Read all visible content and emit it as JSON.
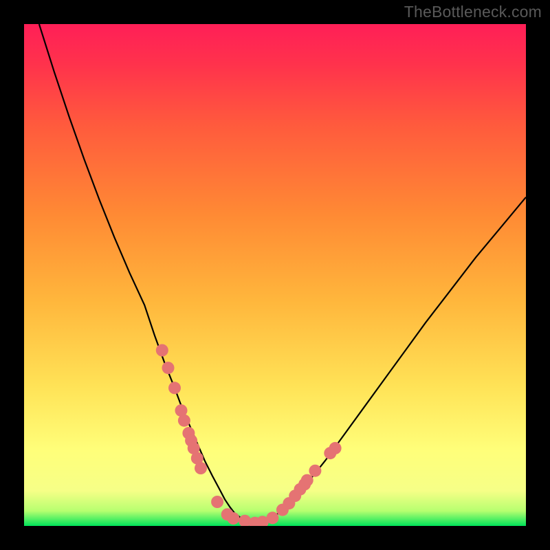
{
  "watermark": "TheBottleneck.com",
  "chart_data": {
    "type": "line",
    "title": "",
    "xlabel": "",
    "ylabel": "",
    "xlim": [
      0,
      100
    ],
    "ylim": [
      0,
      100
    ],
    "gradient_bands": [
      {
        "pos": 0.0,
        "color": "#00e35a"
      },
      {
        "pos": 0.03,
        "color": "#b7ff70"
      },
      {
        "pos": 0.07,
        "color": "#f6ff87"
      },
      {
        "pos": 0.15,
        "color": "#ffff7a"
      },
      {
        "pos": 0.28,
        "color": "#ffe256"
      },
      {
        "pos": 0.45,
        "color": "#ffb63c"
      },
      {
        "pos": 0.62,
        "color": "#ff8a34"
      },
      {
        "pos": 0.8,
        "color": "#ff5a3d"
      },
      {
        "pos": 0.92,
        "color": "#ff324c"
      },
      {
        "pos": 1.0,
        "color": "#ff1f57"
      }
    ],
    "series": [
      {
        "name": "bottleneck-curve",
        "x": [
          3,
          6,
          9,
          12,
          15,
          18,
          21,
          24,
          26,
          28,
          30,
          31.5,
          33,
          34.5,
          36,
          37.5,
          39,
          40,
          41,
          42,
          44,
          46,
          48,
          50,
          53,
          56,
          60,
          64,
          68,
          72,
          76,
          80,
          85,
          90,
          95,
          100
        ],
        "y": [
          100,
          90.5,
          81.5,
          73,
          65,
          57.5,
          50.5,
          44,
          38,
          32.5,
          27.5,
          23.5,
          20,
          16.5,
          13,
          10,
          7.2,
          5.3,
          3.8,
          2.5,
          1.0,
          0.4,
          0.8,
          2.0,
          4.5,
          8.0,
          13.0,
          18.5,
          24.0,
          29.5,
          35.0,
          40.5,
          47.0,
          53.5,
          59.5,
          65.5
        ]
      }
    ],
    "scatter": [
      {
        "name": "points-left",
        "color": "#e57373",
        "radius": 9,
        "x": [
          27.5,
          28.7,
          30.0,
          31.3,
          31.9,
          32.8,
          33.3,
          33.8,
          34.5,
          35.2
        ],
        "y": [
          35.0,
          31.5,
          27.5,
          23.0,
          21.0,
          18.5,
          17.0,
          15.5,
          13.5,
          11.5
        ]
      },
      {
        "name": "points-bottom",
        "color": "#e57373",
        "radius": 9,
        "x": [
          38.5,
          40.5,
          41.7,
          44.0,
          46.0,
          47.5,
          49.5
        ],
        "y": [
          4.8,
          2.3,
          1.5,
          1.0,
          0.6,
          0.8,
          1.6
        ]
      },
      {
        "name": "points-right",
        "color": "#e57373",
        "radius": 9,
        "x": [
          51.5,
          52.8,
          54.0,
          55.0,
          55.9,
          56.4,
          58.0,
          61.0,
          62.0
        ],
        "y": [
          3.2,
          4.5,
          6.0,
          7.3,
          8.3,
          9.1,
          11.0,
          14.5,
          15.5
        ]
      }
    ]
  }
}
